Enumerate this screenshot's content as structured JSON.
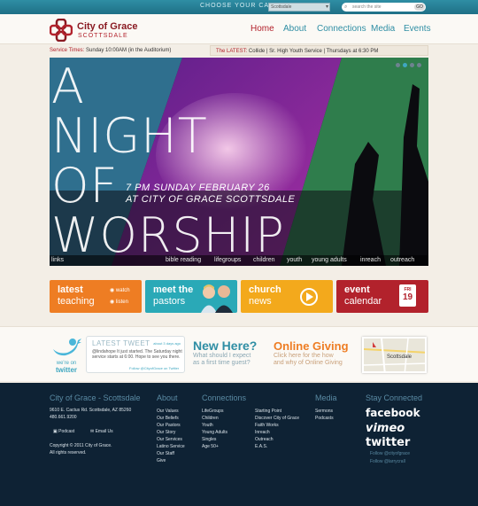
{
  "topbar": {
    "campus_label": "CHOOSE YOUR CAMPUS:",
    "campus_value": "Scottsdale",
    "search_placeholder": "search the site",
    "search_button": "GO"
  },
  "header": {
    "logo_name": "City of Grace",
    "logo_sub": "SCOTTSDALE",
    "nav": [
      "Home",
      "About",
      "Connections",
      "Media",
      "Events"
    ],
    "brand_color": "#b2222c",
    "accent_color": "#2f8ea4"
  },
  "ticker": {
    "service_label": "Service Times:",
    "service_value": "Sunday 10:00AM (in the Auditorium)",
    "latest_label": "The LATEST:",
    "latest_value": "Collide | Sr. High Youth Service | Thursdays at 6:30 PM"
  },
  "hero": {
    "lines": [
      "A",
      "NIGHT",
      "OF",
      "WORSHIP"
    ],
    "sub1": "7 PM SUNDAY FEBRUARY 26",
    "sub2": "AT CITY OF GRACE SCOTTSDALE",
    "links": [
      "links",
      "bible reading",
      "lifegroups",
      "children",
      "youth",
      "young adults",
      "inreach",
      "outreach"
    ]
  },
  "tiles": {
    "teaching": {
      "line1": "latest",
      "line2": "teaching",
      "watch": "watch",
      "listen": "listen",
      "color": "#ee7d23"
    },
    "pastors": {
      "line1": "meet the",
      "line2": "pastors",
      "color": "#2aa9b7"
    },
    "news": {
      "line1": "church",
      "line2": "news",
      "color": "#f3a91c"
    },
    "calendar": {
      "line1": "event",
      "line2": "calendar",
      "day": "FRI",
      "date": "19",
      "color": "#b2222c"
    }
  },
  "strip": {
    "twitter_label1": "we're on",
    "twitter_label2": "twitter",
    "tweet_title": "LATEST TWEET",
    "tweet_age": "about 3 days ago",
    "tweet_text": "@lindahope It just started. The Saturday night service starts at 6:00. Hope to see you there.",
    "tweet_follow": "Follow @CityofGrace on Twitter",
    "newhere_title": "New Here?",
    "newhere_text1": "What should I expect",
    "newhere_text2": "as a first time guest?",
    "giving_title": "Online Giving",
    "giving_text1": "Click here for the how",
    "giving_text2": "and why of Online Giving",
    "map_label": "Scottsdale"
  },
  "footer": {
    "church_title": "City of Grace - Scottsdale",
    "address": "9610 E. Cactus Rd. Scottsdale, AZ 85260",
    "phone": "480.661.9200",
    "podcast": "Podcast",
    "email": "Email Us",
    "copyright1": "Copyright © 2011 City of Grace.",
    "copyright2": "All rights reserved.",
    "about_title": "About",
    "about_links": [
      "Our Values",
      "Our Beliefs",
      "Our Pastors",
      "Our Story",
      "Our Services",
      "Latino Service",
      "Our Staff",
      "Give"
    ],
    "connections_title": "Connections",
    "connections_col1": [
      "LifeGroups",
      "Children",
      "Youth",
      "Young Adults",
      "Singles",
      "Age 50+"
    ],
    "connections_col2": [
      "Starting Point",
      "Discover City of Grace",
      "Faith Works",
      "Inreach",
      "Outreach",
      "E.A.S."
    ],
    "media_title": "Media",
    "media_links": [
      "Sermons",
      "Podcasts"
    ],
    "stay_title": "Stay Connected",
    "social": [
      "facebook",
      "vimeo",
      "twitter"
    ],
    "follow1": "Follow @cityofgrace",
    "follow2": "Follow @larrycrall"
  }
}
